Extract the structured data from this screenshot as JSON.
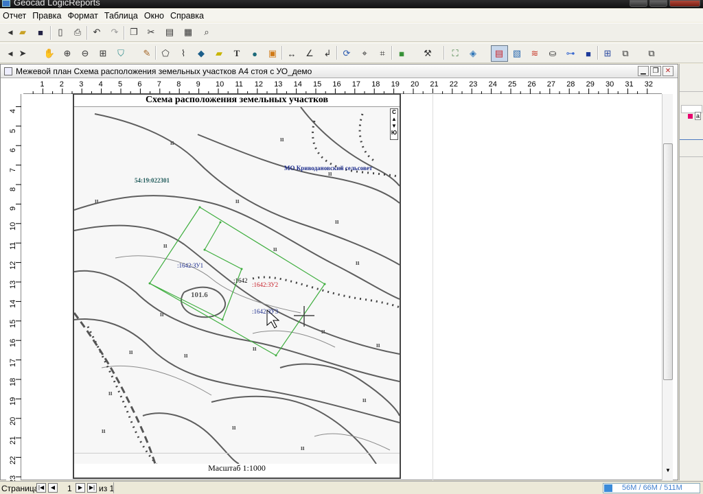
{
  "window": {
    "title": "Geocad LogicReports"
  },
  "menu": {
    "items": [
      "Отчет",
      "Правка",
      "Формат",
      "Таблица",
      "Окно",
      "Справка"
    ]
  },
  "document": {
    "title": "Межевой план Схема расположения земельных участков А4 стоя с УО_демо",
    "page_title": "Схема расположения земельных участков",
    "scale_label": "Масштаб 1:1000",
    "north_label": [
      "С",
      "Ю"
    ]
  },
  "ruler": {
    "horizontal": [
      "1",
      "2",
      "3",
      "4",
      "5",
      "6",
      "7",
      "8",
      "9",
      "10",
      "11",
      "12",
      "13",
      "14",
      "15",
      "16",
      "17",
      "18",
      "19",
      "20",
      "21",
      "22",
      "23",
      "24",
      "25",
      "26",
      "27",
      "28",
      "29",
      "30",
      "31",
      "32"
    ],
    "vertical": [
      "4",
      "5",
      "6",
      "7",
      "8",
      "9",
      "10",
      "11",
      "12",
      "13",
      "14",
      "15",
      "16",
      "17",
      "18",
      "19",
      "20",
      "21",
      "22",
      "23"
    ]
  },
  "map": {
    "cadastral_quarter": "54:19:022301",
    "municipality": "МО Криводановский сельсовет",
    "parcels": [
      {
        "label": ":1642:ЗУ1",
        "color": "#1c2c8c"
      },
      {
        "label": ":1642",
        "color": "#000000"
      },
      {
        "label": ":1642:ЗУ2",
        "color": "#c8202a"
      },
      {
        "label": ":1642:ЗУ3",
        "color": "#1c2c8c"
      }
    ],
    "elevation_label": "101.6",
    "boundary_color": "#3fae3f"
  },
  "statusbar": {
    "page_label": "Страница",
    "page_number": "1",
    "of_label": "из 1",
    "memory": "56M / 66M / 511M"
  }
}
